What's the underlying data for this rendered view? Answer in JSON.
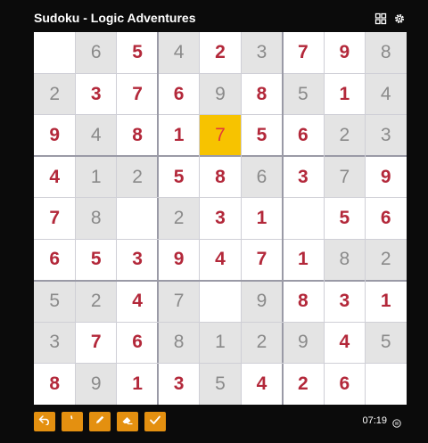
{
  "header": {
    "title": "Sudoku - Logic Adventures",
    "icons": [
      "grid-icon",
      "settings-icon"
    ]
  },
  "board": {
    "cells": [
      [
        {
          "v": "",
          "t": "empty"
        },
        {
          "v": "6",
          "t": "given"
        },
        {
          "v": "5",
          "t": "filled"
        },
        {
          "v": "4",
          "t": "given"
        },
        {
          "v": "2",
          "t": "filled"
        },
        {
          "v": "3",
          "t": "given"
        },
        {
          "v": "7",
          "t": "filled"
        },
        {
          "v": "9",
          "t": "filled"
        },
        {
          "v": "8",
          "t": "given"
        }
      ],
      [
        {
          "v": "2",
          "t": "given"
        },
        {
          "v": "3",
          "t": "filled"
        },
        {
          "v": "7",
          "t": "filled"
        },
        {
          "v": "6",
          "t": "filled"
        },
        {
          "v": "9",
          "t": "given"
        },
        {
          "v": "8",
          "t": "filled"
        },
        {
          "v": "5",
          "t": "given"
        },
        {
          "v": "1",
          "t": "filled"
        },
        {
          "v": "4",
          "t": "given"
        }
      ],
      [
        {
          "v": "9",
          "t": "filled"
        },
        {
          "v": "4",
          "t": "given"
        },
        {
          "v": "8",
          "t": "filled"
        },
        {
          "v": "1",
          "t": "filled"
        },
        {
          "v": "7",
          "t": "selected"
        },
        {
          "v": "5",
          "t": "filled"
        },
        {
          "v": "6",
          "t": "filled"
        },
        {
          "v": "2",
          "t": "given"
        },
        {
          "v": "3",
          "t": "given"
        }
      ],
      [
        {
          "v": "4",
          "t": "filled"
        },
        {
          "v": "1",
          "t": "given"
        },
        {
          "v": "2",
          "t": "given"
        },
        {
          "v": "5",
          "t": "filled"
        },
        {
          "v": "8",
          "t": "filled"
        },
        {
          "v": "6",
          "t": "given"
        },
        {
          "v": "3",
          "t": "filled"
        },
        {
          "v": "7",
          "t": "given"
        },
        {
          "v": "9",
          "t": "filled"
        }
      ],
      [
        {
          "v": "7",
          "t": "filled"
        },
        {
          "v": "8",
          "t": "given"
        },
        {
          "v": "",
          "t": "empty"
        },
        {
          "v": "2",
          "t": "given"
        },
        {
          "v": "3",
          "t": "filled"
        },
        {
          "v": "1",
          "t": "filled"
        },
        {
          "v": "",
          "t": "empty"
        },
        {
          "v": "5",
          "t": "filled"
        },
        {
          "v": "6",
          "t": "filled"
        }
      ],
      [
        {
          "v": "6",
          "t": "filled"
        },
        {
          "v": "5",
          "t": "filled"
        },
        {
          "v": "3",
          "t": "filled"
        },
        {
          "v": "9",
          "t": "filled"
        },
        {
          "v": "4",
          "t": "filled"
        },
        {
          "v": "7",
          "t": "filled"
        },
        {
          "v": "1",
          "t": "filled"
        },
        {
          "v": "8",
          "t": "given"
        },
        {
          "v": "2",
          "t": "given"
        }
      ],
      [
        {
          "v": "5",
          "t": "given"
        },
        {
          "v": "2",
          "t": "given"
        },
        {
          "v": "4",
          "t": "filled"
        },
        {
          "v": "7",
          "t": "given"
        },
        {
          "v": "",
          "t": "empty"
        },
        {
          "v": "9",
          "t": "given"
        },
        {
          "v": "8",
          "t": "filled"
        },
        {
          "v": "3",
          "t": "filled"
        },
        {
          "v": "1",
          "t": "filled"
        }
      ],
      [
        {
          "v": "3",
          "t": "given"
        },
        {
          "v": "7",
          "t": "filled"
        },
        {
          "v": "6",
          "t": "filled"
        },
        {
          "v": "8",
          "t": "given"
        },
        {
          "v": "1",
          "t": "given"
        },
        {
          "v": "2",
          "t": "given"
        },
        {
          "v": "9",
          "t": "given"
        },
        {
          "v": "4",
          "t": "filled"
        },
        {
          "v": "5",
          "t": "given"
        }
      ],
      [
        {
          "v": "8",
          "t": "filled"
        },
        {
          "v": "9",
          "t": "given"
        },
        {
          "v": "1",
          "t": "filled"
        },
        {
          "v": "3",
          "t": "filled"
        },
        {
          "v": "5",
          "t": "given"
        },
        {
          "v": "4",
          "t": "filled"
        },
        {
          "v": "2",
          "t": "filled"
        },
        {
          "v": "6",
          "t": "filled"
        },
        {
          "v": "",
          "t": "empty"
        }
      ]
    ]
  },
  "toolbar": {
    "tools": [
      {
        "name": "undo-button",
        "icon": "undo-icon"
      },
      {
        "name": "notes-button",
        "icon": "tick-mark-icon"
      },
      {
        "name": "pencil-button",
        "icon": "pencil-icon"
      },
      {
        "name": "erase-button",
        "icon": "eraser-icon"
      },
      {
        "name": "check-button",
        "icon": "checkmark-icon"
      }
    ]
  },
  "timer": {
    "value": "07:19"
  },
  "colors": {
    "background": "#0b0b0b",
    "accent": "#e49010",
    "selected": "#f7c300",
    "filled_digit": "#b3283a",
    "given_digit": "#8a8a8a",
    "shade": "#e4e4e4"
  }
}
